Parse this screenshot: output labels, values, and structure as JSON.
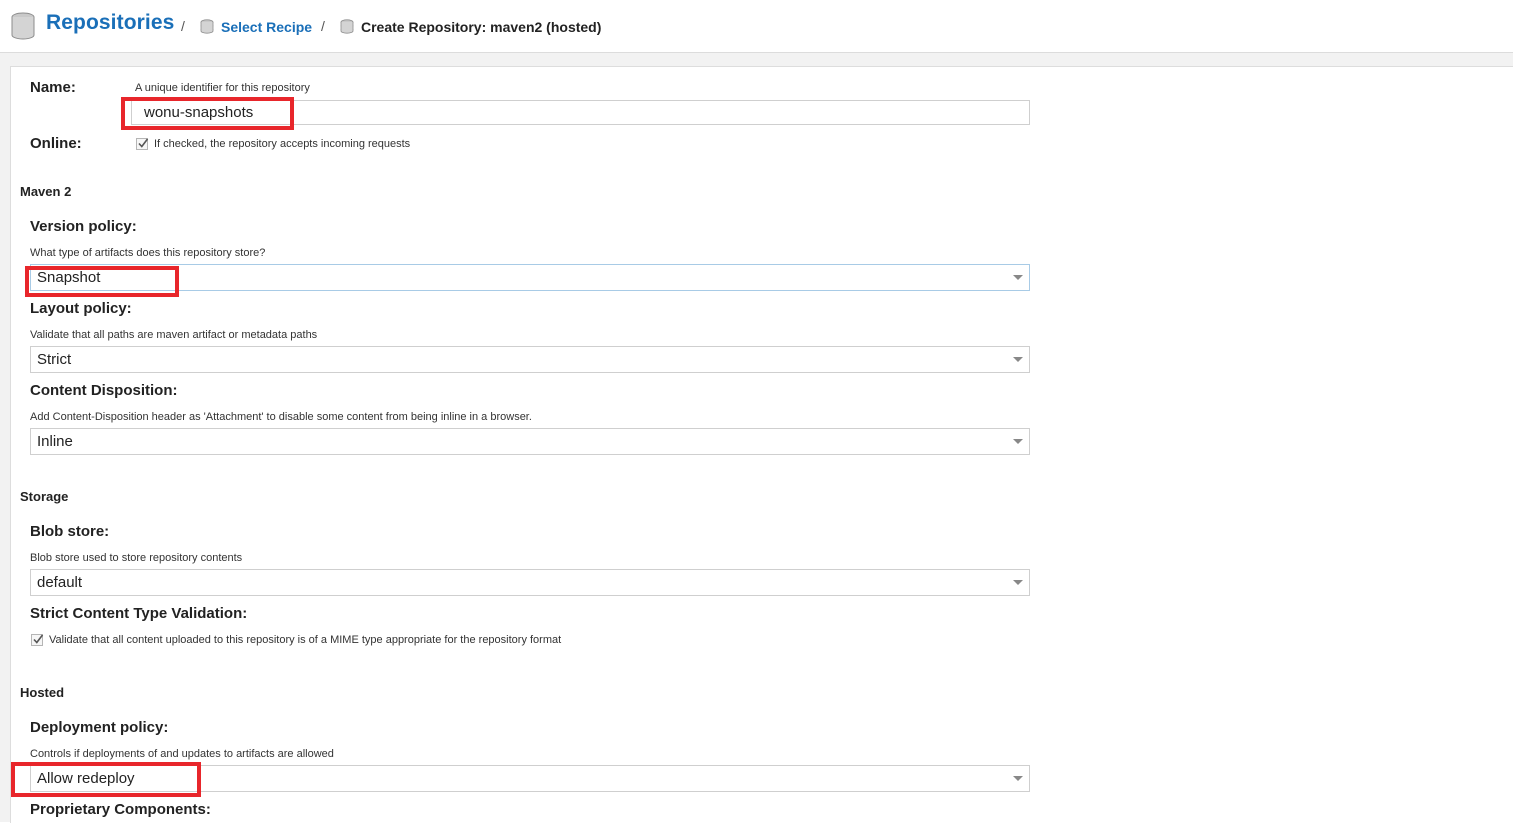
{
  "breadcrumb": {
    "title": "Repositories",
    "separator": "/",
    "link": "Select Recipe",
    "current": "Create Repository: maven2 (hosted)"
  },
  "form": {
    "name": {
      "label": "Name:",
      "help": "A unique identifier for this repository",
      "value": "wonu-snapshots"
    },
    "online": {
      "label": "Online:",
      "help": "If checked, the repository accepts incoming requests",
      "checked": true
    },
    "maven2": {
      "section": "Maven 2",
      "version_policy": {
        "label": "Version policy:",
        "help": "What type of artifacts does this repository store?",
        "value": "Snapshot"
      },
      "layout_policy": {
        "label": "Layout policy:",
        "help": "Validate that all paths are maven artifact or metadata paths",
        "value": "Strict"
      },
      "content_disposition": {
        "label": "Content Disposition:",
        "help": "Add Content-Disposition header as 'Attachment' to disable some content from being inline in a browser.",
        "value": "Inline"
      }
    },
    "storage": {
      "section": "Storage",
      "blob_store": {
        "label": "Blob store:",
        "help": "Blob store used to store repository contents",
        "value": "default"
      },
      "strict_content": {
        "label": "Strict Content Type Validation:",
        "help": "Validate that all content uploaded to this repository is of a MIME type appropriate for the repository format",
        "checked": true
      }
    },
    "hosted": {
      "section": "Hosted",
      "deployment_policy": {
        "label": "Deployment policy:",
        "help": "Controls if deployments of and updates to artifacts are allowed",
        "value": "Allow redeploy"
      },
      "proprietary": {
        "label": "Proprietary Components:"
      }
    }
  },
  "colors": {
    "link": "#1a6fb8",
    "highlight": "#e8262b",
    "panel_bg": "#f2f2f2"
  },
  "icons": [
    "database-icon",
    "dropdown-arrow-icon",
    "checkmark-icon"
  ]
}
